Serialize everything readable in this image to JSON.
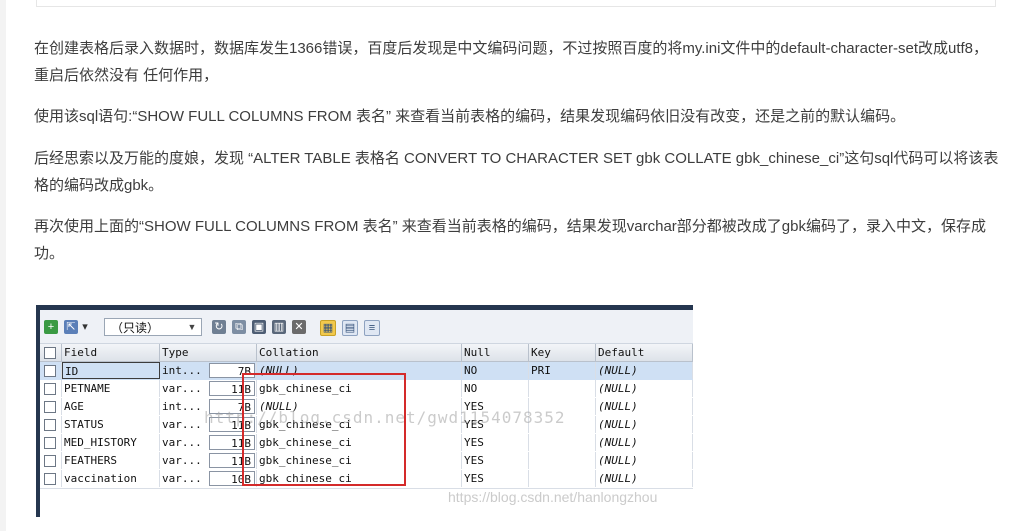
{
  "article": {
    "p1": "在创建表格后录入数据时，数据库发生1366错误，百度后发现是中文编码问题，不过按照百度的将my.ini文件中的default-character-set改成utf8，重启后依然没有 任何作用，",
    "p2": "使用该sql语句:“SHOW FULL COLUMNS FROM 表名” 来查看当前表格的编码，结果发现编码依旧没有改变，还是之前的默认编码。",
    "p3": "后经思索以及万能的度娘，发现 “ALTER TABLE 表格名 CONVERT TO CHARACTER SET gbk COLLATE gbk_chinese_ci”这句sql代码可以将该表格的编码改成gbk。",
    "p4": "再次使用上面的“SHOW FULL COLUMNS FROM 表名” 来查看当前表格的编码，结果发现varchar部分都被改成了gbk编码了，录入中文，保存成功。"
  },
  "tool": {
    "mode_combo": "（只读）",
    "columns": [
      "Field",
      "Type",
      "Collation",
      "Null",
      "Key",
      "Default"
    ],
    "rows": [
      {
        "field": "ID",
        "type": "int...",
        "len": "7B",
        "collation": "(NULL)",
        "null": "NO",
        "key": "PRI",
        "default": "(NULL)"
      },
      {
        "field": "PETNAME",
        "type": "var...",
        "len": "11B",
        "collation": "gbk_chinese_ci",
        "null": "NO",
        "key": "",
        "default": "(NULL)"
      },
      {
        "field": "AGE",
        "type": "int...",
        "len": "7B",
        "collation": "(NULL)",
        "null": "YES",
        "key": "",
        "default": "(NULL)"
      },
      {
        "field": "STATUS",
        "type": "var...",
        "len": "11B",
        "collation": "gbk_chinese_ci",
        "null": "YES",
        "key": "",
        "default": "(NULL)"
      },
      {
        "field": "MED_HISTORY",
        "type": "var...",
        "len": "11B",
        "collation": "gbk_chinese_ci",
        "null": "YES",
        "key": "",
        "default": "(NULL)"
      },
      {
        "field": "FEATHERS",
        "type": "var...",
        "len": "11B",
        "collation": "gbk_chinese_ci",
        "null": "YES",
        "key": "",
        "default": "(NULL)"
      },
      {
        "field": "vaccination",
        "type": "var...",
        "len": "10B",
        "collation": "gbk_chinese_ci",
        "null": "YES",
        "key": "",
        "default": "(NULL)"
      }
    ],
    "watermark_mid": "http://blog.csdn.net/gwd1154078352",
    "watermark_br": "https://blog.csdn.net/hanlongzhou",
    "icons": [
      "add-row-icon",
      "export-icon",
      "dropdown-icon",
      "refresh-icon",
      "copy-icon",
      "save-icon",
      "delete-icon",
      "cancel-icon",
      "grid-view-icon",
      "form-view-icon",
      "text-view-icon"
    ],
    "colors": {
      "highlight_box": "#d42a2a",
      "frame": "#25364f",
      "selected_row": "#cfe0f4"
    }
  }
}
